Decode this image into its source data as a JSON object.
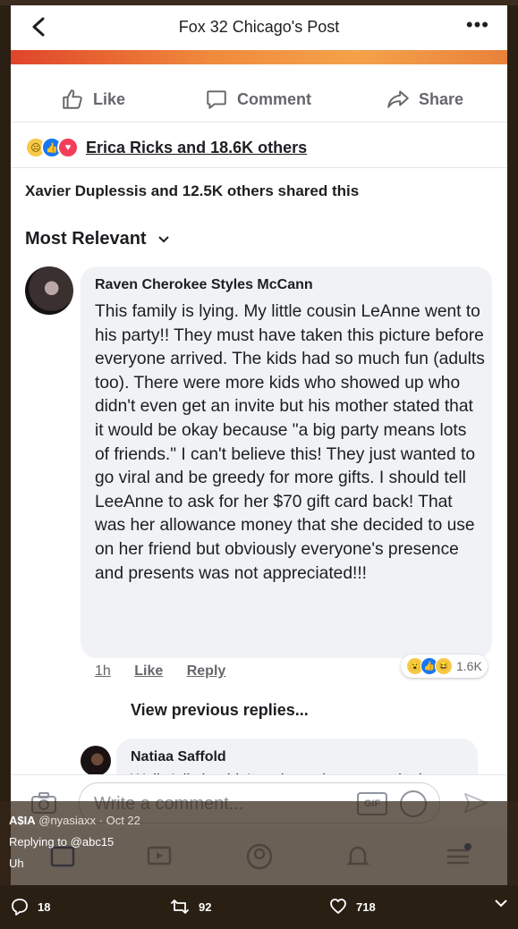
{
  "header": {
    "title": "Fox 32 Chicago's Post"
  },
  "actions": {
    "like": "Like",
    "comment": "Comment",
    "share": "Share"
  },
  "reactions": {
    "summary": "Erica Ricks and 18.6K others"
  },
  "shares": {
    "text": "Xavier Duplessis and 12.5K others shared this"
  },
  "sort": {
    "label": "Most Relevant"
  },
  "comment1": {
    "author": "Raven Cherokee Styles McCann",
    "text": "This family is lying.  My little cousin LeAnne went to his party!! They must have taken this picture before everyone arrived.  The kids had so much fun (adults too). There were more kids who showed up who didn't even get an invite but his mother stated that it would be okay because  \"a big party means lots of friends.\" I can't believe this! They just wanted to go viral and be greedy for more gifts. I should tell LeeAnne to ask for her $70 gift card back! That was her allowance money that she decided to use on her friend but obviously everyone's presence and presents was not appreciated!!!",
    "time": "1h",
    "like_label": "Like",
    "reply_label": "Reply",
    "reaction_count": "1.6K"
  },
  "view_previous": "View previous replies...",
  "comment2": {
    "author": "Natiaa Saffold",
    "text": "Well y'all shouldn't and people are mentioning"
  },
  "composer": {
    "placeholder": "Write a comment...",
    "gif_label": "GIF"
  },
  "tweet": {
    "name": "A$IA",
    "handle": "@nyasiaxx",
    "date": "· Oct 22",
    "replying_prefix": "Replying to",
    "replying_to": "@abc15",
    "text": "Uh"
  },
  "tweet_actions": {
    "replies": "18",
    "retweets": "92",
    "likes": "718"
  },
  "colors": {
    "facebook_blue": "#1877f2",
    "overlay": "#342618",
    "frame": "#2a1f13"
  }
}
